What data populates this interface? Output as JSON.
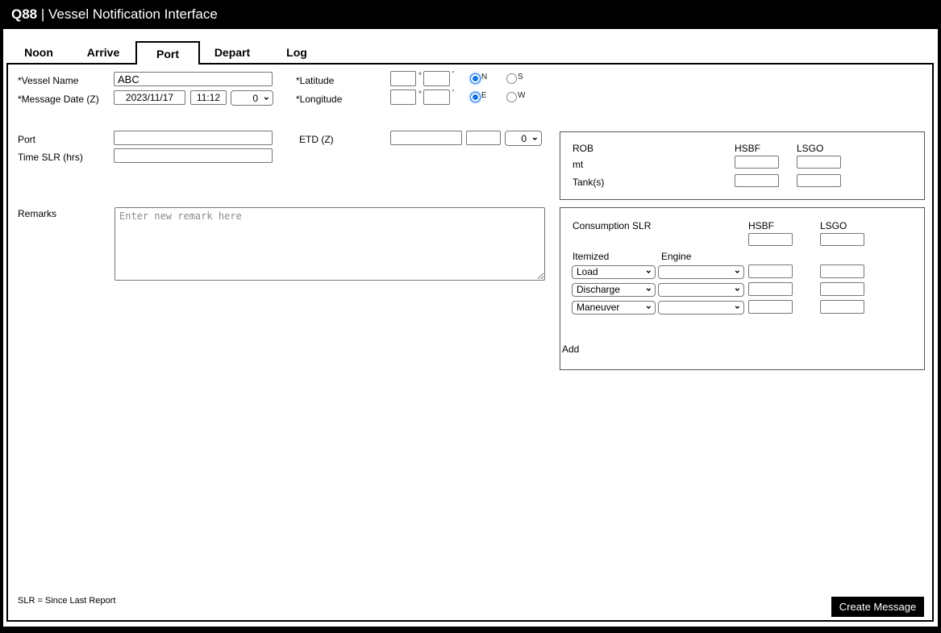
{
  "header": {
    "brand": "Q88",
    "separator": " | ",
    "title": "Vessel Notification Interface"
  },
  "tabs": {
    "items": [
      {
        "label": "Noon"
      },
      {
        "label": "Arrive"
      },
      {
        "label": "Port"
      },
      {
        "label": "Depart"
      },
      {
        "label": "Log"
      }
    ],
    "active": "Port"
  },
  "units": {
    "degree": "°",
    "minute": "′"
  },
  "form": {
    "vessel_name": {
      "label": "*Vessel Name",
      "value": "ABC"
    },
    "message_date": {
      "label": "*Message Date (Z)",
      "date": "2023/11/17",
      "time": "11:12",
      "tz": "0"
    },
    "latitude": {
      "label": "*Latitude",
      "degrees": "",
      "minutes": "",
      "hemispheres": [
        "N",
        "S"
      ],
      "selected": "N"
    },
    "longitude": {
      "label": "*Longitude",
      "degrees": "",
      "minutes": "",
      "hemispheres": [
        "E",
        "W"
      ],
      "selected": "E"
    },
    "port": {
      "label": "Port",
      "value": ""
    },
    "etd": {
      "label": "ETD (Z)",
      "date": "",
      "time": "",
      "tz": "0"
    },
    "time_slr": {
      "label": "Time SLR (hrs)",
      "value": ""
    },
    "remarks": {
      "label": "Remarks",
      "placeholder": "Enter new remark here",
      "value": ""
    }
  },
  "rob": {
    "title": "ROB",
    "columns": [
      "HSBF",
      "LSGO"
    ],
    "row_labels": [
      "mt",
      "Tank(s)"
    ],
    "values": {
      "mt_hsbf": "",
      "mt_lsgo": "",
      "tanks_hsbf": "",
      "tanks_lsgo": ""
    }
  },
  "consumption": {
    "title": "Consumption SLR",
    "columns": [
      "HSBF",
      "LSGO"
    ],
    "total_hsbf": "",
    "total_lsgo": "",
    "itemized_header": "Itemized",
    "engine_header": "Engine",
    "rows": [
      {
        "itemized": "Load",
        "engine": "",
        "hsbf": "",
        "lsgo": ""
      },
      {
        "itemized": "Discharge",
        "engine": "",
        "hsbf": "",
        "lsgo": ""
      },
      {
        "itemized": "Maneuver",
        "engine": "",
        "hsbf": "",
        "lsgo": ""
      }
    ],
    "add_label": "Add"
  },
  "footer": {
    "legend": "SLR = Since Last Report",
    "create_button_label": "Create Message"
  }
}
